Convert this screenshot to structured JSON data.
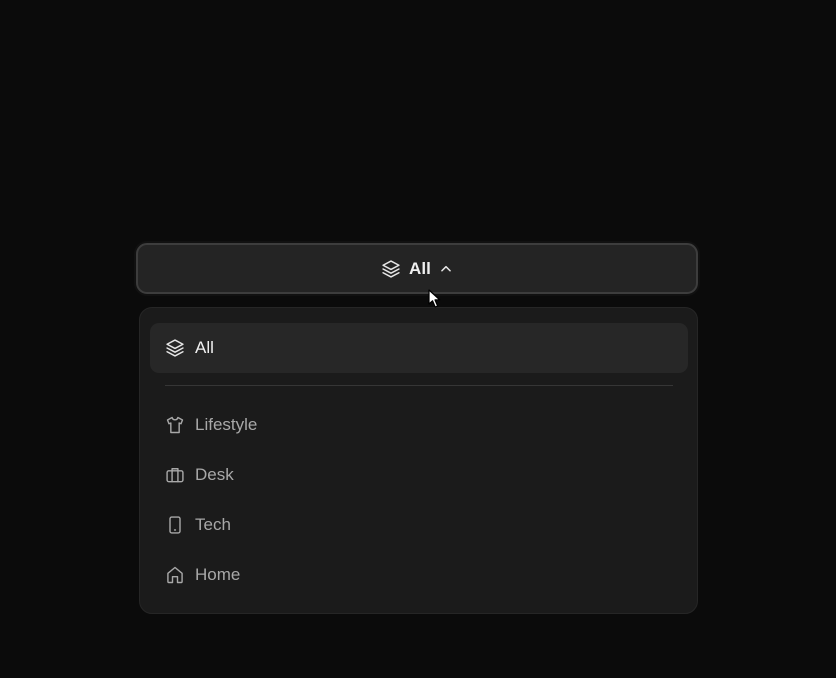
{
  "filter": {
    "selected_label": "All",
    "selected_icon": "layers-icon",
    "expanded": true
  },
  "menu": {
    "all_item": {
      "label": "All",
      "icon": "layers-icon",
      "selected": true
    },
    "items": [
      {
        "label": "Lifestyle",
        "icon": "shirt-icon"
      },
      {
        "label": "Desk",
        "icon": "briefcase-icon"
      },
      {
        "label": "Tech",
        "icon": "smartphone-icon"
      },
      {
        "label": "Home",
        "icon": "home-icon"
      }
    ]
  },
  "colors": {
    "background": "#0b0b0b",
    "trigger_bg": "#242424",
    "menu_bg": "#1b1b1b",
    "selected_bg": "#272727",
    "text_primary": "#f0f0f0",
    "text_muted": "#a8a8a8"
  }
}
